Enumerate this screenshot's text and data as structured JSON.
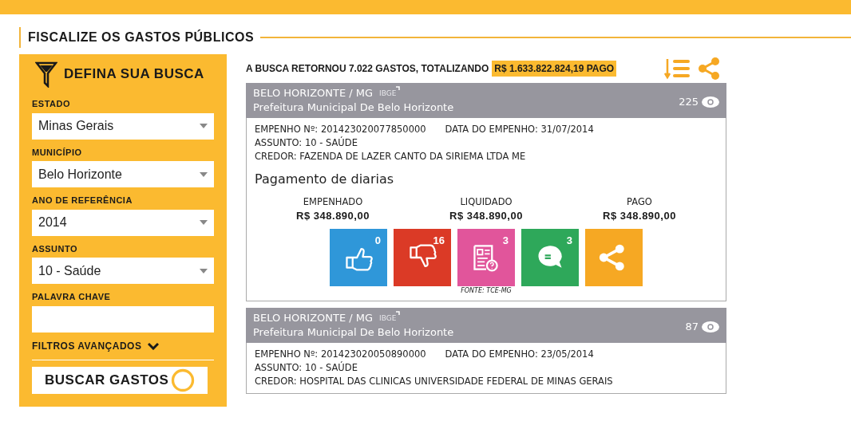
{
  "page_title": "FISCALIZE OS GASTOS PÚBLICOS",
  "sidebar": {
    "title": "DEFINA SUA BUSCA",
    "fields": [
      {
        "label": "ESTADO",
        "kind": "select",
        "value": "Minas Gerais"
      },
      {
        "label": "MUNICÍPIO",
        "kind": "select",
        "value": "Belo Horizonte"
      },
      {
        "label": "ANO DE REFERÊNCIA",
        "kind": "select",
        "value": "2014"
      },
      {
        "label": "ASSUNTO",
        "kind": "select",
        "value": "10 - Saúde"
      },
      {
        "label": "PALAVRA CHAVE",
        "kind": "text"
      }
    ],
    "advanced_filters": "FILTROS AVANÇADOS",
    "search_button": "BUSCAR GASTOS"
  },
  "results": {
    "summary": "A BUSCA RETORNOU 7.022 GASTOS, TOTALIZANDO",
    "total": "R$ 1.633.822.824,19 PAGO"
  },
  "expenses": [
    {
      "city": "BELO HORIZONTE / MG",
      "ibge": "IBGE",
      "agency": "Prefeitura Municipal De Belo Horizonte",
      "views": "225",
      "empenho": "EMPENHO Nº: 201423020077850000",
      "date": "DATA DO EMPENHO: 31/07/2014",
      "subject": "ASSUNTO: 10 - SAÚDE",
      "creditor": "CREDOR: FAZENDA DE LAZER CANTO DA SIRIEMA LTDA ME",
      "description": "Pagamento de diarias",
      "amounts": [
        {
          "label": "EMPENHADO",
          "value": "R$ 348.890,00"
        },
        {
          "label": "LIQUIDADO",
          "value": "R$ 348.890,00"
        },
        {
          "label": "PAGO",
          "value": "R$ 348.890,00"
        }
      ],
      "actions": [
        {
          "kind": "like",
          "count": "0",
          "color": "#2f97d9"
        },
        {
          "kind": "dislike",
          "count": "16",
          "color": "#db3a26"
        },
        {
          "kind": "report",
          "count": "3",
          "color": "#e1559b"
        },
        {
          "kind": "comment",
          "count": "3",
          "color": "#2ea85a"
        },
        {
          "kind": "share",
          "color": "#f6a823"
        }
      ],
      "source": "FONTE: TCE-MG"
    },
    {
      "city": "BELO HORIZONTE / MG",
      "ibge": "IBGE",
      "agency": "Prefeitura Municipal De Belo Horizonte",
      "views": "87",
      "empenho": "EMPENHO Nº: 201423020050890000",
      "date": "DATA DO EMPENHO: 23/05/2014",
      "subject": "ASSUNTO: 10 - SAÚDE",
      "creditor": "CREDOR: HOSPITAL DAS CLINICAS UNIVERSIDADE FEDERAL DE MINAS GERAIS"
    }
  ]
}
